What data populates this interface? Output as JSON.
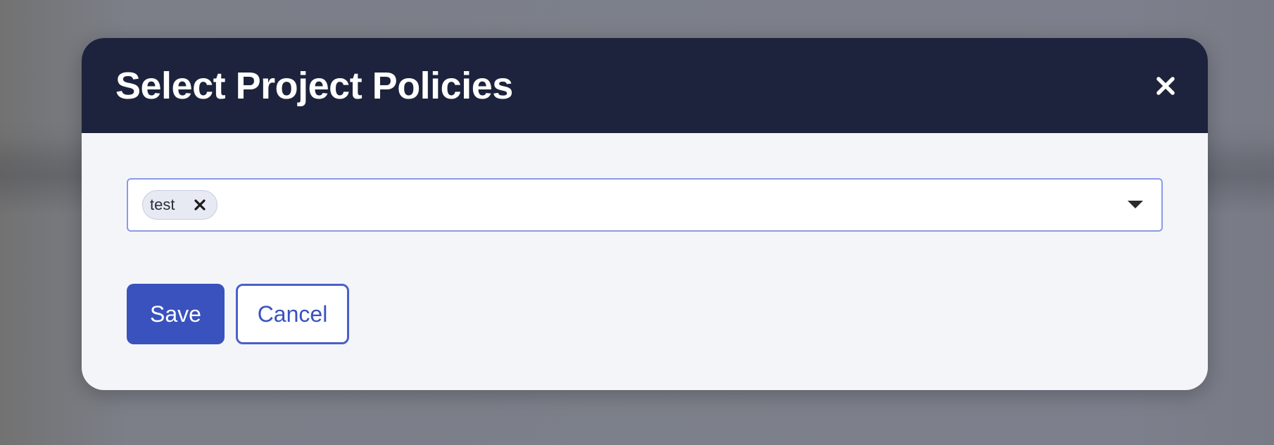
{
  "dialog": {
    "title": "Select Project Policies",
    "close_icon": "close-icon"
  },
  "policy_select": {
    "selected": [
      {
        "label": "test",
        "remove_icon": "close-icon"
      }
    ],
    "toggle_icon": "caret-down-icon"
  },
  "actions": {
    "save_label": "Save",
    "cancel_label": "Cancel"
  },
  "colors": {
    "header_bg": "#1d233c",
    "body_bg": "#f4f5f9",
    "accent": "#3a52be",
    "select_border": "#8b9be6"
  }
}
